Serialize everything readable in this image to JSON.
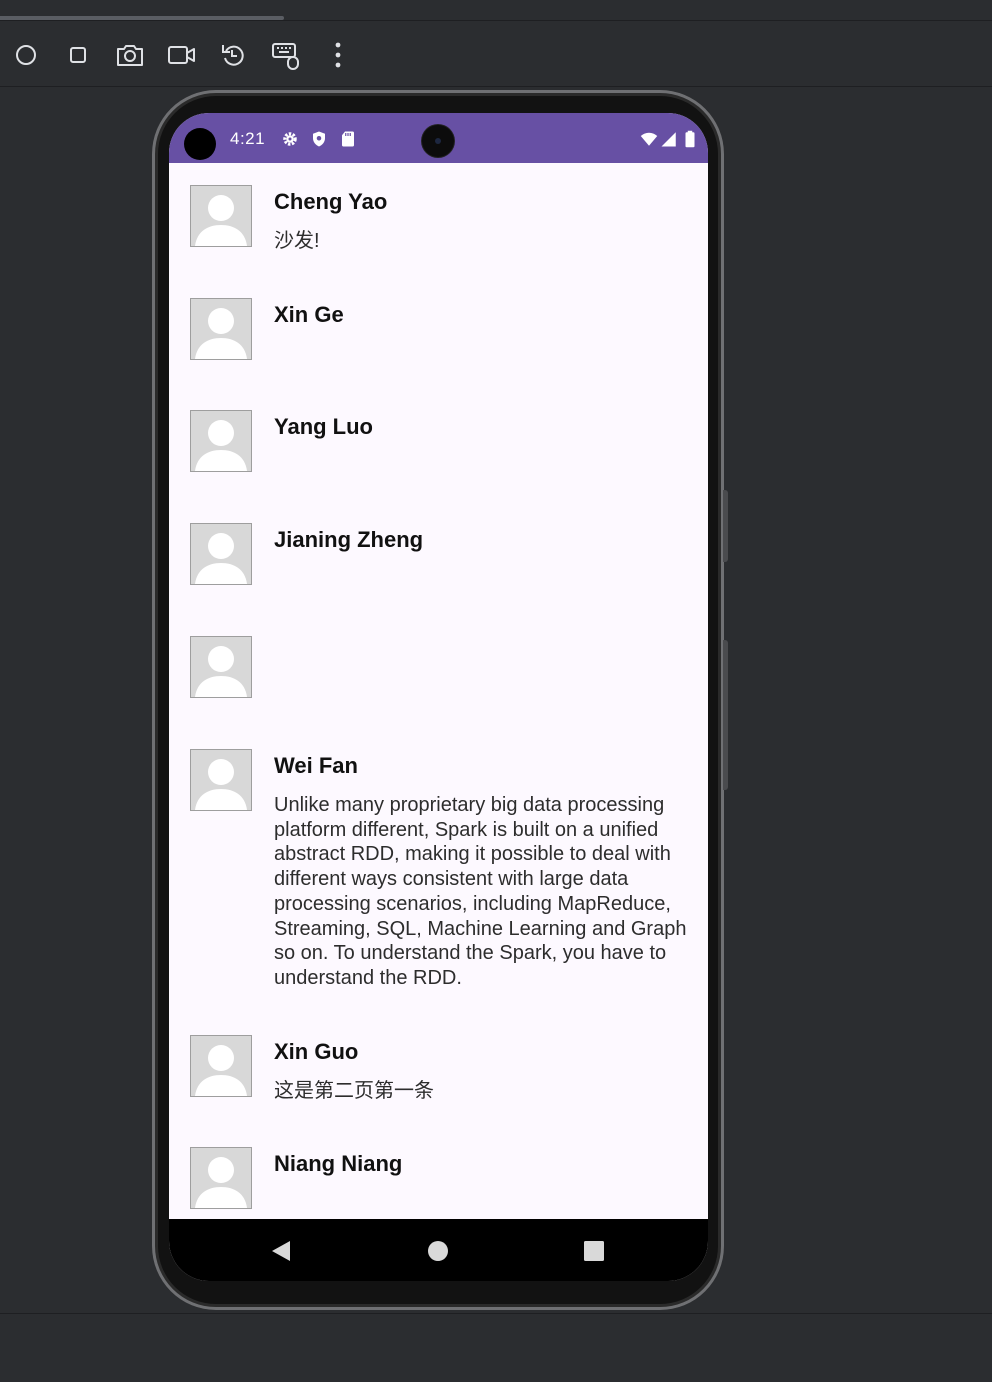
{
  "status_bar": {
    "time": "4:21",
    "left_icons": [
      "settings-icon",
      "shield-icon",
      "sd-card-icon"
    ],
    "right_icons": [
      "wifi-icon",
      "cell-signal-icon",
      "battery-icon"
    ]
  },
  "toolbar": {
    "icons": [
      "power-icon",
      "overview-icon",
      "screenshot-camera-icon",
      "screen-record-icon",
      "rotate-icon",
      "keyboard-mouse-icon",
      "more-options-icon"
    ]
  },
  "comments": [
    {
      "name": "Cheng Yao",
      "content": "沙发!"
    },
    {
      "name": "Xin Ge",
      "content": ""
    },
    {
      "name": "Yang Luo",
      "content": ""
    },
    {
      "name": "Jianing Zheng",
      "content": ""
    },
    {
      "name": "",
      "content": ""
    },
    {
      "name": "Wei Fan",
      "content": "Unlike many proprietary big data processing platform different, Spark is built on a unified abstract RDD, making it possible to deal with different ways consistent with large data processing scenarios, including MapReduce, Streaming, SQL, Machine Learning and Graph so on. To understand the Spark, you have to understand the RDD."
    },
    {
      "name": "Xin Guo",
      "content": "这是第二页第一条"
    },
    {
      "name": "Niang Niang",
      "content": ""
    }
  ],
  "nav_bar": {
    "icons": [
      "back-icon",
      "home-icon",
      "recents-icon"
    ]
  },
  "colors": {
    "status_bar": "#6750a4",
    "list_background": "#fdf9ff",
    "ide_background": "#2b2d30"
  }
}
